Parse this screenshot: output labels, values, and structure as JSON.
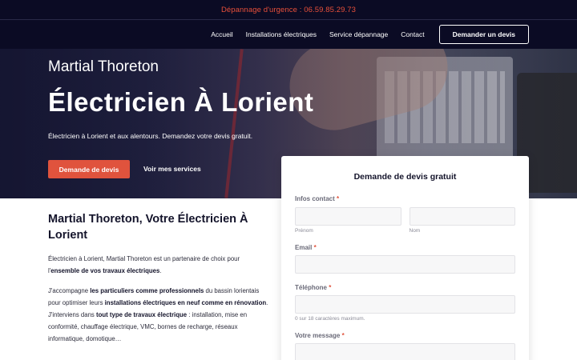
{
  "topbar": {
    "emergency": "Dépannage d'urgence : 06.59.85.29.73"
  },
  "nav": {
    "links": [
      "Accueil",
      "Installations électriques",
      "Service dépannage",
      "Contact"
    ],
    "cta": "Demander un devis"
  },
  "hero": {
    "name": "Martial Thoreton",
    "title": "Électricien À Lorient",
    "subtitle": "Électricien à Lorient et aux alentours. Demandez votre devis gratuit.",
    "primary_button": "Demande de devis",
    "secondary_link": "Voir mes services"
  },
  "content": {
    "heading": "Martial Thoreton, Votre Électricien À Lorient",
    "p1_a": "Électricien à Lorient, Martial Thoreton est un partenaire de choix pour l'",
    "p1_b": "ensemble de vos travaux électriques",
    "p1_c": ".",
    "p2_a": "J'accompagne ",
    "p2_b": "les particuliers comme professionnels",
    "p2_c": " du bassin lorientais pour optimiser leurs ",
    "p2_d": "installations électriques en neuf comme en rénovation",
    "p2_e": ". J'interviens dans ",
    "p2_f": "tout type de travaux électrique",
    "p2_g": " : installation, mise en conformité, chauffage électrique, VMC, bornes de recharge, réseaux informatique, domotique…"
  },
  "form": {
    "title": "Demande de devis gratuit",
    "contact_label": "Infos contact",
    "first_name_hint": "Prénom",
    "last_name_hint": "Nom",
    "email_label": "Email",
    "phone_label": "Téléphone",
    "phone_hint": "0 sur 18 caractères maximum.",
    "message_label": "Votre message",
    "required_mark": "*"
  }
}
